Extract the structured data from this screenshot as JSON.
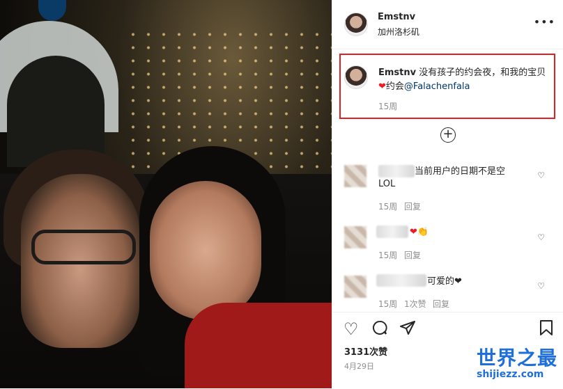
{
  "post": {
    "username": "Emstnv",
    "location": "加州洛杉矶",
    "more_icon": "more-dots-icon"
  },
  "caption": {
    "username": "Emstnv",
    "text_before": " 没有孩子的约会夜，和我的宝贝",
    "text_after": "约会",
    "mention": "@Falachenfala",
    "time": "15周"
  },
  "comments": [
    {
      "text": " 当前用户的日期不是空",
      "text2": "LOL",
      "time": "15周",
      "reply": "回复"
    },
    {
      "text": "❤👏",
      "time": "15周",
      "reply": "回复"
    },
    {
      "text": " 可爱的❤",
      "time": "15周",
      "likes": "1次赞",
      "reply": "回复"
    }
  ],
  "footer": {
    "likes": "3131次赞",
    "date": "4月29日"
  },
  "watermark": {
    "title": "世界之最",
    "url": "shijiezz.com"
  },
  "colors": {
    "highlight_border": "#e02020",
    "heart": "#ed1c24",
    "mention": "#00376b",
    "watermark": "#1e6fd9"
  }
}
